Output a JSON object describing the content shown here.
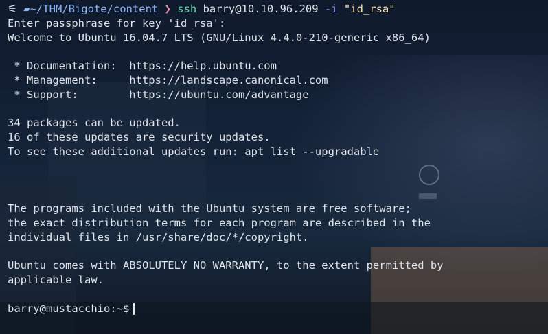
{
  "prompt": {
    "logo_glyph": "⚟",
    "folder_glyph": "📁",
    "cwd": "~/THM/Bigote/content",
    "arrow": "❯",
    "command": "ssh",
    "args_host": " barry@10.10.96.209 ",
    "flag": "-i",
    "flag_value": " \"id_rsa\""
  },
  "output": {
    "l1": "Enter passphrase for key 'id_rsa':",
    "l2": "Welcome to Ubuntu 16.04.7 LTS (GNU/Linux 4.4.0-210-generic x86_64)",
    "l3": "",
    "l4": " * Documentation:  https://help.ubuntu.com",
    "l5": " * Management:     https://landscape.canonical.com",
    "l6": " * Support:        https://ubuntu.com/advantage",
    "l7": "",
    "l8": "34 packages can be updated.",
    "l9": "16 of these updates are security updates.",
    "l10": "To see these additional updates run: apt list --upgradable",
    "l11": "",
    "l12": "",
    "l13": "",
    "l14": "The programs included with the Ubuntu system are free software;",
    "l15": "the exact distribution terms for each program are described in the",
    "l16": "individual files in /usr/share/doc/*/copyright.",
    "l17": "",
    "l18": "Ubuntu comes with ABSOLUTELY NO WARRANTY, to the extent permitted by",
    "l19": "applicable law.",
    "l20": ""
  },
  "shell_prompt": "barry@mustacchio:~$",
  "colors": {
    "path": "#89b4fa",
    "arrow": "#f38ba8",
    "command": "#5fd7a8",
    "string": "#f9e2af",
    "text": "#dfe3ea"
  },
  "background": "anime-style night street scene"
}
